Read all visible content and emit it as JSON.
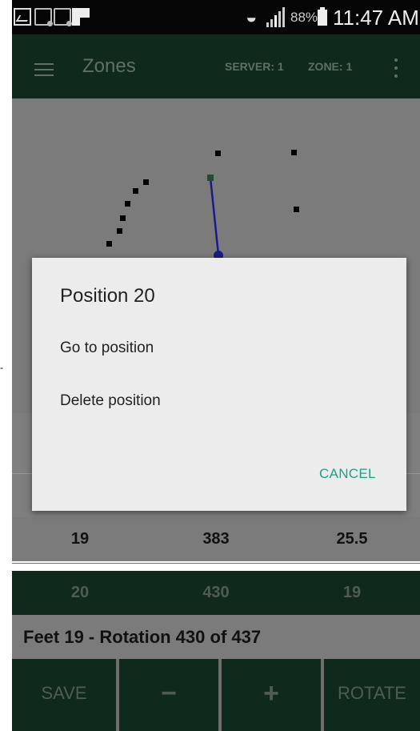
{
  "status_bar": {
    "battery": "88%",
    "time": "11:47 AM"
  },
  "app_bar": {
    "title": "Zones",
    "server": "SERVER: 1",
    "zone": "ZONE: 1"
  },
  "canvas": {
    "path_points_color": "#000000",
    "line_color": "#1a1a8a",
    "selected_point_color": "#1f4d2e"
  },
  "rows": [
    {
      "a": "19",
      "b": "383",
      "c": "25.5"
    },
    {
      "a": "20",
      "b": "430",
      "c": "19"
    }
  ],
  "summary": "Feet 19 - Rotation 430 of 437",
  "bottom_bar": {
    "save": "SAVE",
    "minus": "−",
    "plus": "+",
    "rotate": "ROTATE"
  },
  "dialog": {
    "title": "Position 20",
    "go": "Go to position",
    "delete": "Delete position",
    "cancel": "CANCEL"
  },
  "colors": {
    "primary_dark": "#0f2a1c",
    "accent": "#1ea088",
    "dialog_bg": "#ececec"
  }
}
